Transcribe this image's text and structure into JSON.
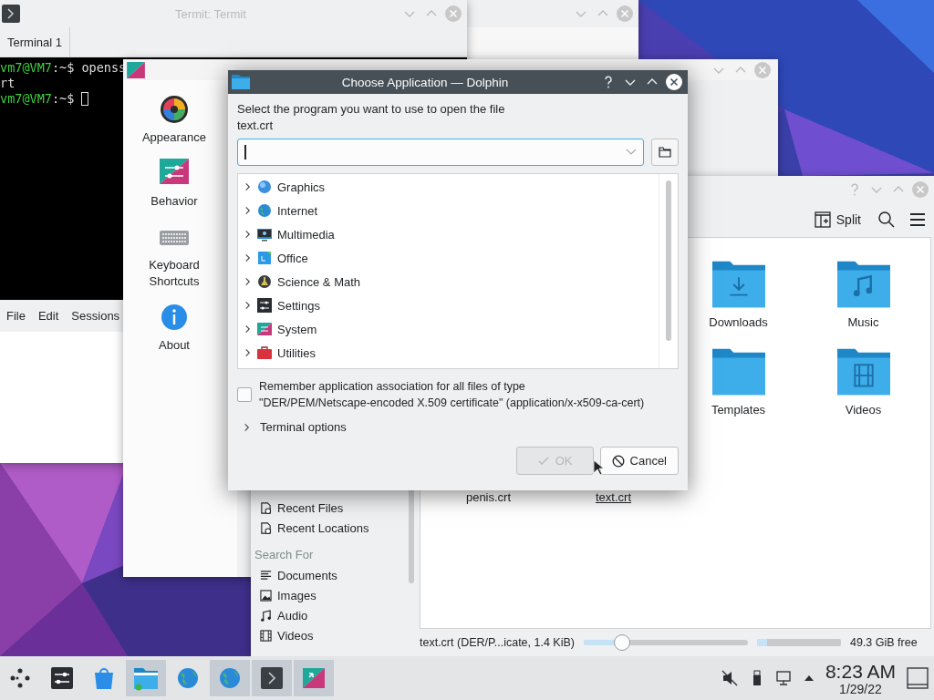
{
  "termit": {
    "title": "Termit: Termit",
    "tabs": [
      {
        "label": "Terminal 1",
        "selected": true
      }
    ],
    "lines": [
      {
        "prompt": "vm7@VM7",
        "text": ":~$ openss"
      },
      {
        "text": "rt"
      },
      {
        "prompt": "vm7@VM7",
        "text": ":~$ ",
        "cursor": true
      }
    ],
    "menu": [
      "File",
      "Edit",
      "Sessions"
    ]
  },
  "settings": {
    "sidebar": [
      {
        "label": "Appearance"
      },
      {
        "label": "Behavior"
      },
      {
        "label": "Keyboard Shortcuts"
      },
      {
        "label": "About"
      }
    ]
  },
  "dolphin": {
    "toolbar": {
      "split": "Split"
    },
    "items": [
      {
        "kind": "empty"
      },
      {
        "kind": "empty"
      },
      {
        "kind": "folder",
        "name": "Downloads"
      },
      {
        "kind": "folder",
        "name": "Music"
      },
      {
        "kind": "empty"
      },
      {
        "kind": "empty"
      },
      {
        "kind": "folder",
        "name": "Templates"
      },
      {
        "kind": "folder",
        "name": "Videos"
      },
      {
        "kind": "file",
        "name": "penis.crt",
        "hovered": false
      },
      {
        "kind": "file",
        "name": "text.crt",
        "hovered": true
      }
    ],
    "places": [
      {
        "kind": "item",
        "label": "Recent Files"
      },
      {
        "kind": "item",
        "label": "Recent Locations"
      },
      {
        "kind": "header",
        "label": "Search For"
      },
      {
        "kind": "item",
        "label": "Documents"
      },
      {
        "kind": "item",
        "label": "Images"
      },
      {
        "kind": "item",
        "label": "Audio"
      },
      {
        "kind": "item",
        "label": "Videos"
      }
    ],
    "status": {
      "file": "text.crt (DER/P...icate, 1.4 KiB)",
      "zoom": {
        "level": 0.2
      },
      "disk": {
        "level": 0.12
      },
      "free": "49.3 GiB free"
    }
  },
  "dialog": {
    "title": "Choose Application — Dolphin",
    "prompt": "Select the program you want to use to open the file",
    "file": "text.crt",
    "categories": [
      {
        "label": "Graphics",
        "expanded": false
      },
      {
        "label": "Internet",
        "expanded": false
      },
      {
        "label": "Multimedia",
        "expanded": false
      },
      {
        "label": "Office",
        "expanded": false
      },
      {
        "label": "Science & Math",
        "expanded": false
      },
      {
        "label": "Settings",
        "expanded": false
      },
      {
        "label": "System",
        "expanded": false
      },
      {
        "label": "Utilities",
        "expanded": false
      }
    ],
    "remember": {
      "label": "Remember application association for all files of type\n\"DER/PEM/Netscape-encoded X.509 certificate\" (application/x-x509-ca-cert)",
      "checked": false
    },
    "terminal_options": {
      "label": "Terminal options",
      "expanded": false
    },
    "buttons": [
      {
        "kind": "ok",
        "label": "OK",
        "disabled": true
      },
      {
        "kind": "cancel",
        "label": "Cancel",
        "disabled": false
      }
    ]
  },
  "taskbar": {
    "items": [
      {
        "active": false
      },
      {
        "active": false
      },
      {
        "active": false
      },
      {
        "active": true
      },
      {
        "active": false
      },
      {
        "active": true
      },
      {
        "active": true
      },
      {
        "active": true
      }
    ],
    "clock": {
      "time": "8:23 AM",
      "date": "1/29/22"
    }
  }
}
